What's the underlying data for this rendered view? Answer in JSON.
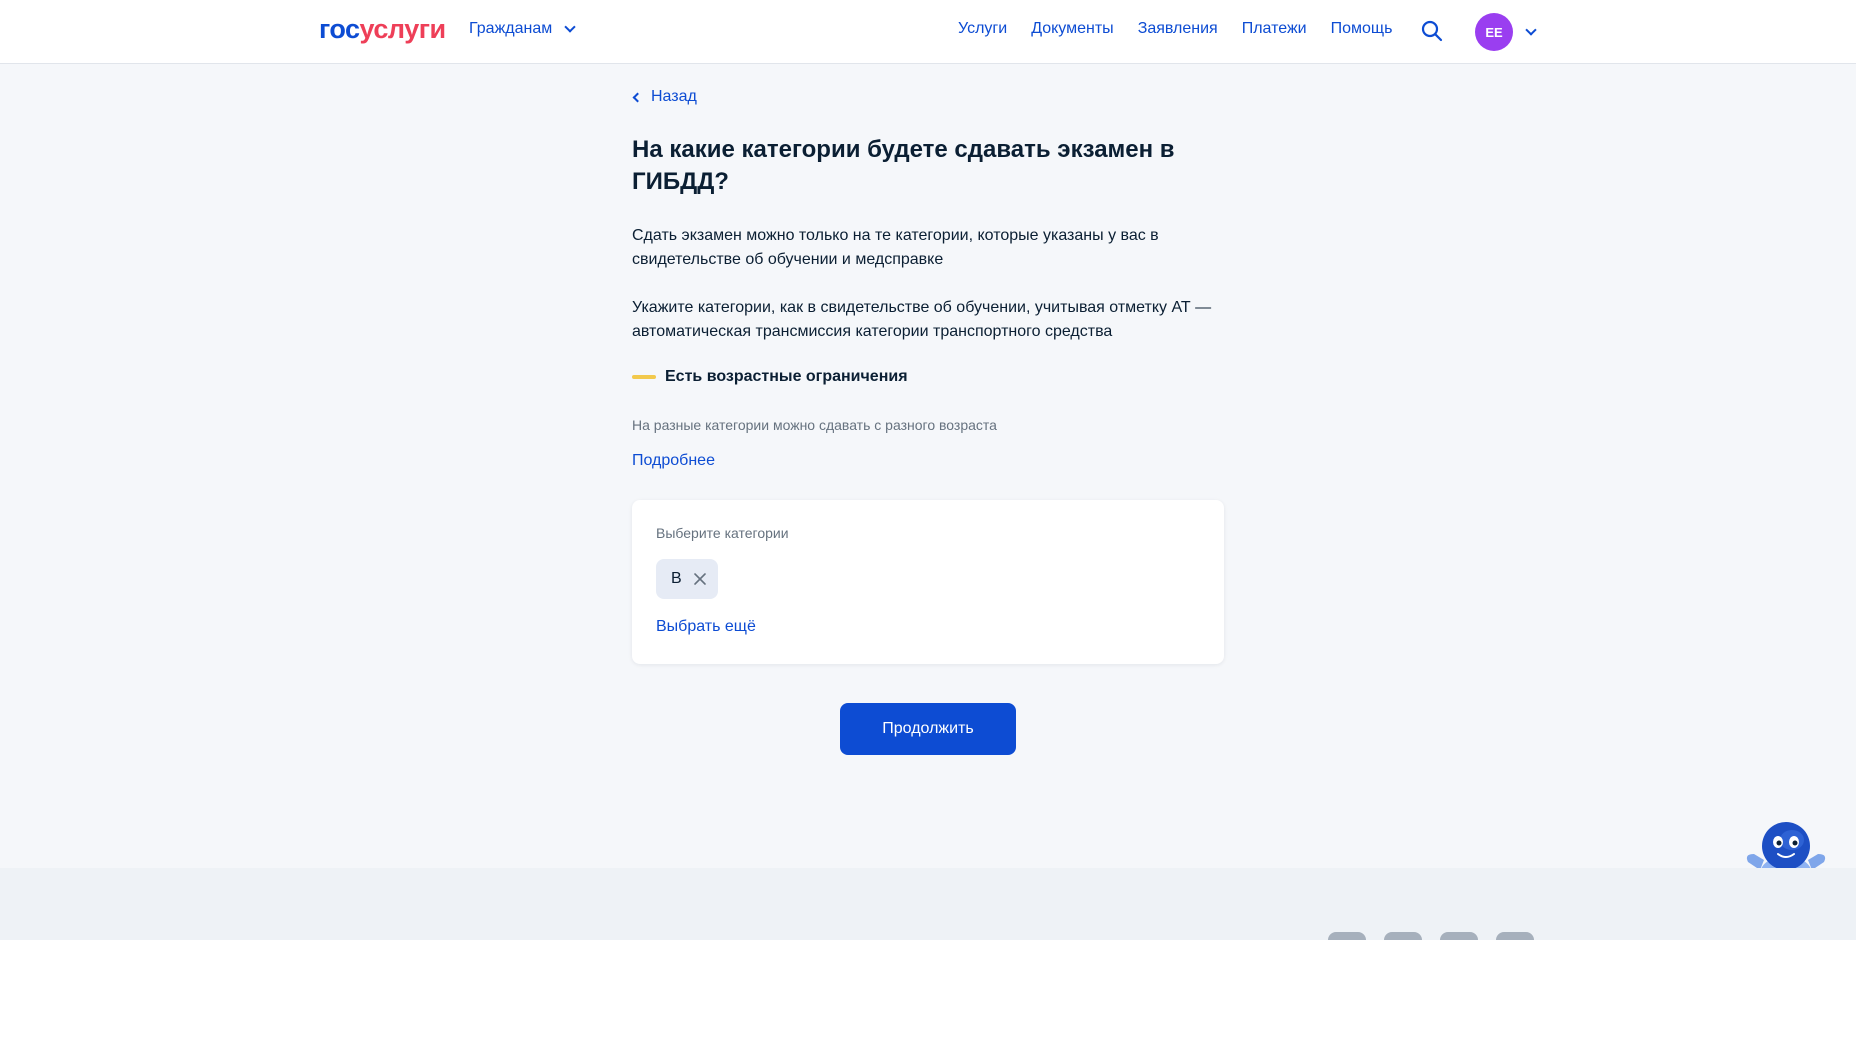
{
  "header": {
    "logo_part1": "гос",
    "logo_part2": "услуги",
    "role_select": "Гражданам",
    "nav": [
      "Услуги",
      "Документы",
      "Заявления",
      "Платежи",
      "Помощь"
    ],
    "avatar_initials": "ЕЕ"
  },
  "main": {
    "back_label": "Назад",
    "title": "На какие категории будете сдавать экзамен в ГИБДД?",
    "paragraph1": "Сдать экзамен можно только на те категории, которые указаны у вас в свидетельстве об обучении и медсправке",
    "paragraph2": "Укажите категории, как в свидетельстве об обучении, учитывая отметку АТ — автоматическая трансмиссия категории транспортного средства",
    "restriction_label": "Есть возрастные ограничения",
    "restriction_hint": "На разные категории можно сдавать с разного возраста",
    "more_link": "Подробнее",
    "card": {
      "label": "Выберите категории",
      "selected_chips": [
        "B"
      ],
      "select_more": "Выбрать ещё"
    },
    "continue_button": "Продолжить"
  },
  "colors": {
    "primary": "#0d4cd3",
    "brand_red": "#ee3f58",
    "avatar_bg": "#9a3ef0",
    "restriction_marker": "#f2c94c",
    "page_bg": "#f5f7fa"
  },
  "icons": {
    "search": "search-icon",
    "chip_remove": "close-icon",
    "back": "chevron-left-icon",
    "dropdown": "chevron-down-icon",
    "assistant": "robot-assistant-icon"
  }
}
